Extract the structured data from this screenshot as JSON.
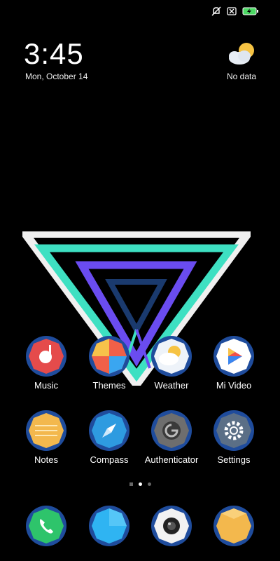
{
  "status_bar": {
    "icons": [
      "mute-icon",
      "sim-off-icon",
      "battery-charging-icon"
    ]
  },
  "clock": {
    "time": "3:45",
    "date": "Mon, October 14"
  },
  "weather_widget": {
    "icon": "partly-cloudy-icon",
    "text": "No data"
  },
  "apps_row1": [
    {
      "label": "Music",
      "icon": "music-icon"
    },
    {
      "label": "Themes",
      "icon": "themes-icon"
    },
    {
      "label": "Weather",
      "icon": "weather-icon"
    },
    {
      "label": "Mi Video",
      "icon": "video-icon"
    }
  ],
  "apps_row2": [
    {
      "label": "Notes",
      "icon": "notes-icon"
    },
    {
      "label": "Compass",
      "icon": "compass-icon"
    },
    {
      "label": "Authenticator",
      "icon": "authenticator-icon"
    },
    {
      "label": "Settings",
      "icon": "settings-icon"
    }
  ],
  "dock": [
    {
      "icon": "phone-icon"
    },
    {
      "icon": "messaging-icon"
    },
    {
      "icon": "camera-icon"
    },
    {
      "icon": "browser-icon"
    }
  ],
  "page_indicator": {
    "pages": 3,
    "active": 1
  },
  "colors": {
    "background": "#000000",
    "icon_ring": "#1f4c9c",
    "teal": "#3ee0c2",
    "purple": "#6a4cf0",
    "navy": "#1a3a6e"
  }
}
